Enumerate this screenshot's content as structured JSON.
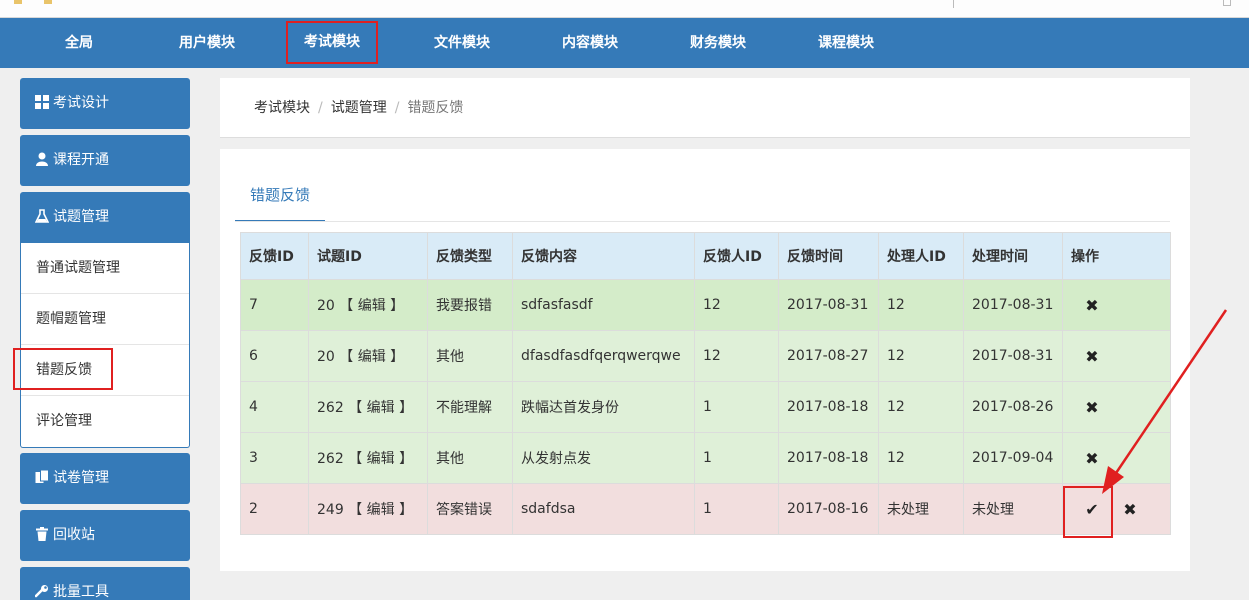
{
  "topnav": {
    "items": [
      "全局",
      "用户模块",
      "考试模块",
      "文件模块",
      "内容模块",
      "财务模块",
      "课程模块"
    ],
    "active": "考试模块"
  },
  "sidebar": {
    "items": [
      {
        "label": "考试设计",
        "icon": "grid-icon"
      },
      {
        "label": "课程开通",
        "icon": "user-icon"
      },
      {
        "label": "试题管理",
        "icon": "flask-icon"
      },
      {
        "label": "试卷管理",
        "icon": "copy-icon"
      },
      {
        "label": "回收站",
        "icon": "trash-icon"
      },
      {
        "label": "批量工具",
        "icon": "wrench-icon"
      }
    ],
    "submenu": [
      "普通试题管理",
      "题帽题管理",
      "错题反馈",
      "评论管理"
    ],
    "active_sub": "错题反馈"
  },
  "breadcrumb": [
    "考试模块",
    "试题管理",
    "错题反馈"
  ],
  "tab": {
    "label": "错题反馈"
  },
  "table": {
    "headers": [
      "反馈ID",
      "试题ID",
      "反馈类型",
      "反馈内容",
      "反馈人ID",
      "反馈时间",
      "处理人ID",
      "处理时间",
      "操作"
    ],
    "edit_label": "【 编辑 】",
    "rows": [
      {
        "id": "7",
        "qid": "20",
        "type": "我要报错",
        "content": "sdfasfasdf",
        "uid": "12",
        "time": "2017-08-31",
        "handler": "12",
        "htime": "2017-08-31",
        "handled": true
      },
      {
        "id": "6",
        "qid": "20",
        "type": "其他",
        "content": "dfasdfasdfqerqwerqwe",
        "uid": "12",
        "time": "2017-08-27",
        "handler": "12",
        "htime": "2017-08-31",
        "handled": true
      },
      {
        "id": "4",
        "qid": "262",
        "type": "不能理解",
        "content": "跌幅达首发身份",
        "uid": "1",
        "time": "2017-08-18",
        "handler": "12",
        "htime": "2017-08-26",
        "handled": true
      },
      {
        "id": "3",
        "qid": "262",
        "type": "其他",
        "content": "从发射点发",
        "uid": "1",
        "time": "2017-08-18",
        "handler": "12",
        "htime": "2017-09-04",
        "handled": true
      },
      {
        "id": "2",
        "qid": "249",
        "type": "答案错误",
        "content": "sdafdsa",
        "uid": "1",
        "time": "2017-08-16",
        "handler": "未处理",
        "htime": "未处理",
        "handled": false
      }
    ]
  },
  "icons": {
    "check": "✔",
    "close": "✖"
  },
  "colors": {
    "primary": "#357ab8",
    "highlight": "#e02020",
    "row_ok": "#dff0d8",
    "row_bad": "#f2dede",
    "header": "#d9ebf7"
  }
}
